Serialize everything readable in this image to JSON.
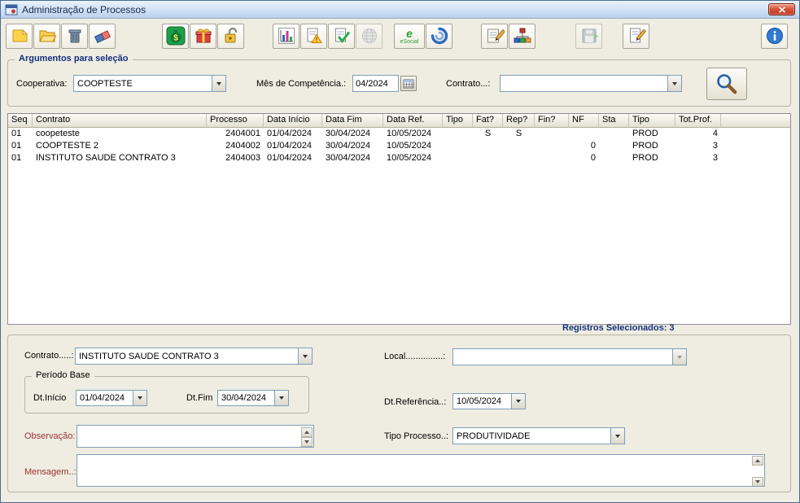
{
  "window": {
    "title": "Administração de Processos"
  },
  "toolbar": {
    "esocial_label": "eSocial",
    "icons": [
      "new-note-icon",
      "open-folder-icon",
      "trash-icon",
      "eraser-icon",
      "money-icon",
      "gift-icon",
      "unlock-icon",
      "bar-chart-icon",
      "alert-doc-icon",
      "check-doc-icon",
      "globe-icon",
      "esocial-icon",
      "swirl-icon",
      "notes-icon",
      "org-chart-icon",
      "export-disk-icon",
      "edit-page-icon",
      "info-icon"
    ]
  },
  "selection": {
    "legend": "Argumentos para seleção",
    "cooperativa": {
      "label": "Cooperativa:",
      "value": "COOPTESTE"
    },
    "competencia": {
      "label": "Mês de Competência.:",
      "value": "04/2024"
    },
    "contrato": {
      "label": "Contrato...:",
      "value": ""
    }
  },
  "table": {
    "columns": [
      "Seq",
      "Contrato",
      "Processo",
      "Data Início",
      "Data Fim",
      "Data Ref.",
      "Tipo",
      "Fat?",
      "Rep?",
      "Fin?",
      "NF",
      "Sta",
      "Tipo",
      "Tot.Prof."
    ],
    "rows": [
      [
        "01",
        "coopeteste",
        "2404001",
        "01/04/2024",
        "30/04/2024",
        "10/05/2024",
        "",
        "S",
        "S",
        "",
        "",
        "",
        "PROD",
        "4"
      ],
      [
        "01",
        "COOPTESTE 2",
        "2404002",
        "01/04/2024",
        "30/04/2024",
        "10/05/2024",
        "",
        "",
        "",
        "",
        "0",
        "",
        "PROD",
        "3"
      ],
      [
        "01",
        "INSTITUTO SAUDE CONTRATO 3",
        "2404003",
        "01/04/2024",
        "30/04/2024",
        "10/05/2024",
        "",
        "",
        "",
        "",
        "0",
        "",
        "PROD",
        "3"
      ]
    ]
  },
  "status": {
    "registros": "Registros Selecionados: 3"
  },
  "detail": {
    "contrato": {
      "label": "Contrato.....:",
      "value": "INSTITUTO SAUDE CONTRATO 3"
    },
    "local": {
      "label": "Local...............:",
      "value": ""
    },
    "periodo": {
      "legend": "Período Base",
      "dt_inicio_label": "Dt.Início",
      "dt_inicio_value": "01/04/2024",
      "dt_fim_label": "Dt.Fim",
      "dt_fim_value": "30/04/2024"
    },
    "dt_referencia": {
      "label": "Dt.Referência..:",
      "value": "10/05/2024"
    },
    "observacao": {
      "label": "Observação:",
      "value": ""
    },
    "tipo_processo": {
      "label": "Tipo Processo..:",
      "value": "PRODUTIVIDADE"
    },
    "mensagem": {
      "label": "Mensagem..:",
      "value": ""
    }
  }
}
